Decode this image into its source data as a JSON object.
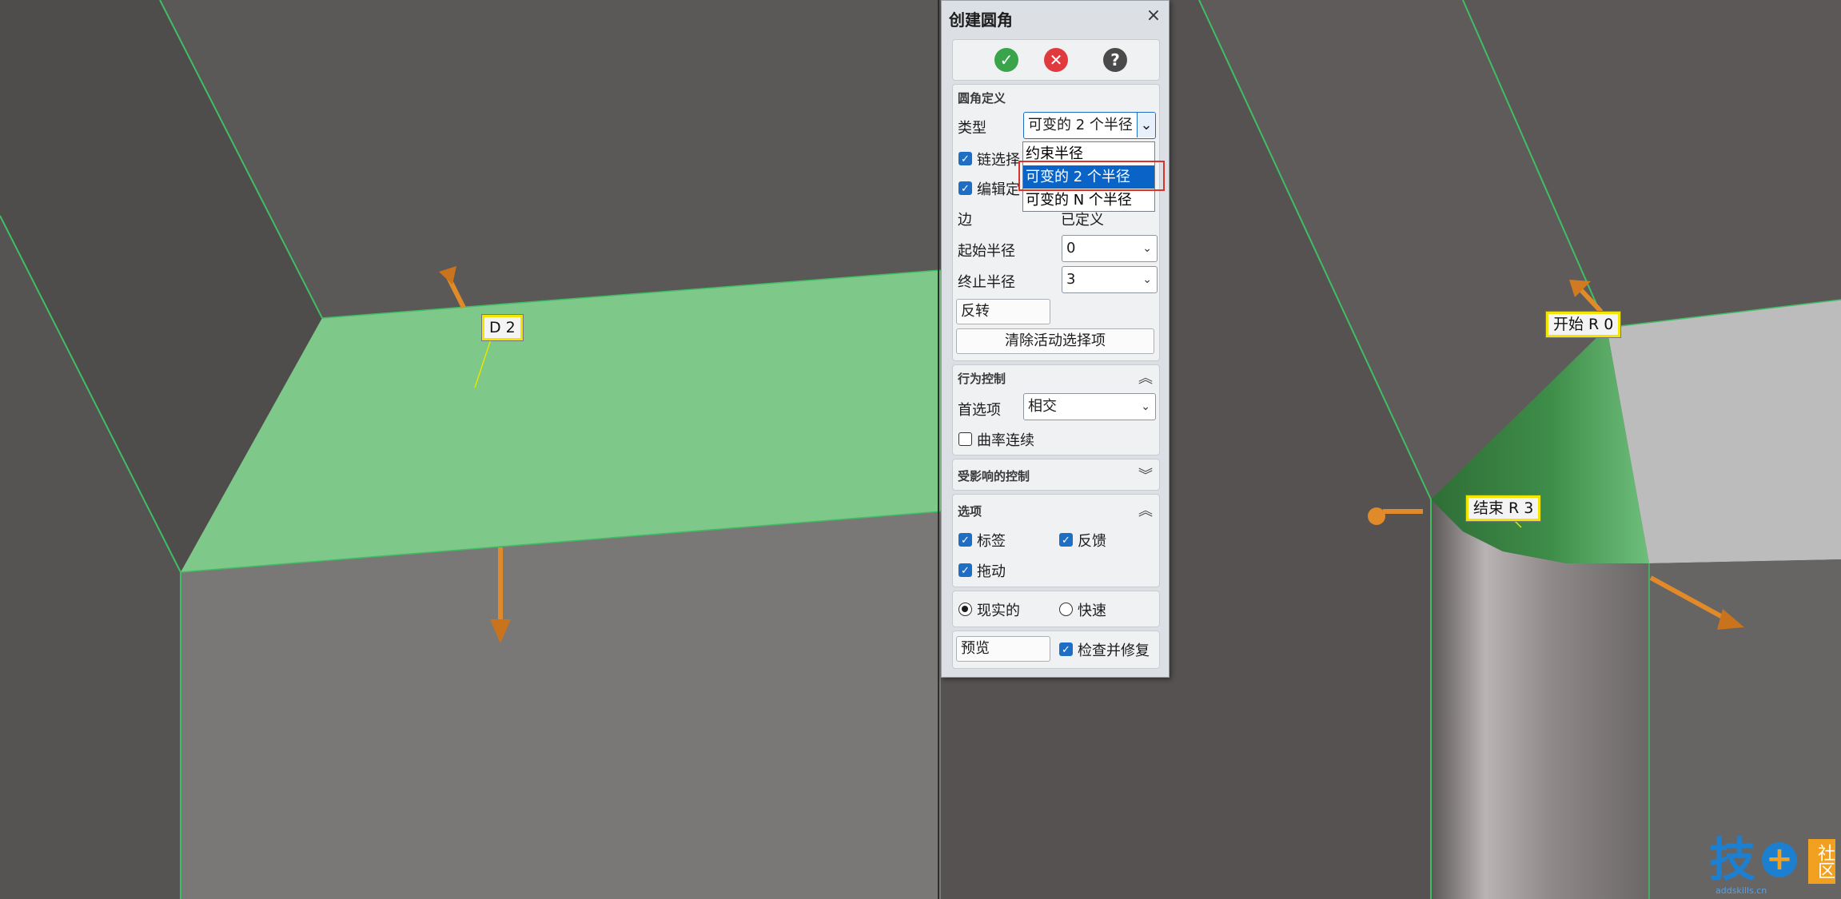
{
  "dialog": {
    "title": "创建圆角",
    "close_glyph": "×",
    "ok_icon": "check-circle-icon",
    "cancel_icon": "cancel-circle-icon",
    "help_glyph": "?",
    "fillet_definition": {
      "title": "圆角定义",
      "type_label": "类型",
      "type_value": "可变的 2 个半径",
      "type_options": [
        "约束半径",
        "可变的 2 个半径",
        "可变的 N 个半径"
      ],
      "chain_select_label": "链选择",
      "chain_select_checked": true,
      "edit_label": "编辑定",
      "edit_checked": true,
      "edge_label": "边",
      "edge_value": "已定义",
      "start_radius_label": "起始半径",
      "start_radius_value": "0",
      "end_radius_label": "终止半径",
      "end_radius_value": "3",
      "reverse_label": "反转",
      "clear_button_label": "清除活动选择项"
    },
    "behavior_control": {
      "title": "行为控制",
      "preference_label": "首选项",
      "preference_value": "相交",
      "curvature_label": "曲率连续",
      "curvature_checked": false
    },
    "affected_control": {
      "title": "受影响的控制"
    },
    "options": {
      "title": "选项",
      "label_option": "标签",
      "feedback_option": "反馈",
      "drag_option": "拖动"
    },
    "render_mode": {
      "realistic_label": "现实的",
      "fast_label": "快速",
      "selected": "realistic"
    },
    "preview_label": "预览",
    "check_repair_label": "检查并修复"
  },
  "viewport": {
    "left_tag": "D 2",
    "start_tag": "开始 R 0",
    "end_tag": "结束 R 3",
    "colors": {
      "green_face": "#7ec88a",
      "dark_green": "#2f7a3b",
      "arrow": "#e08a2a",
      "tag_border": "#f2e500",
      "highlight": "#d9342b",
      "selected": "#0a64c8"
    }
  },
  "watermark": {
    "brand_text": "技",
    "side_text": "社区",
    "url": "addskills.cn"
  }
}
